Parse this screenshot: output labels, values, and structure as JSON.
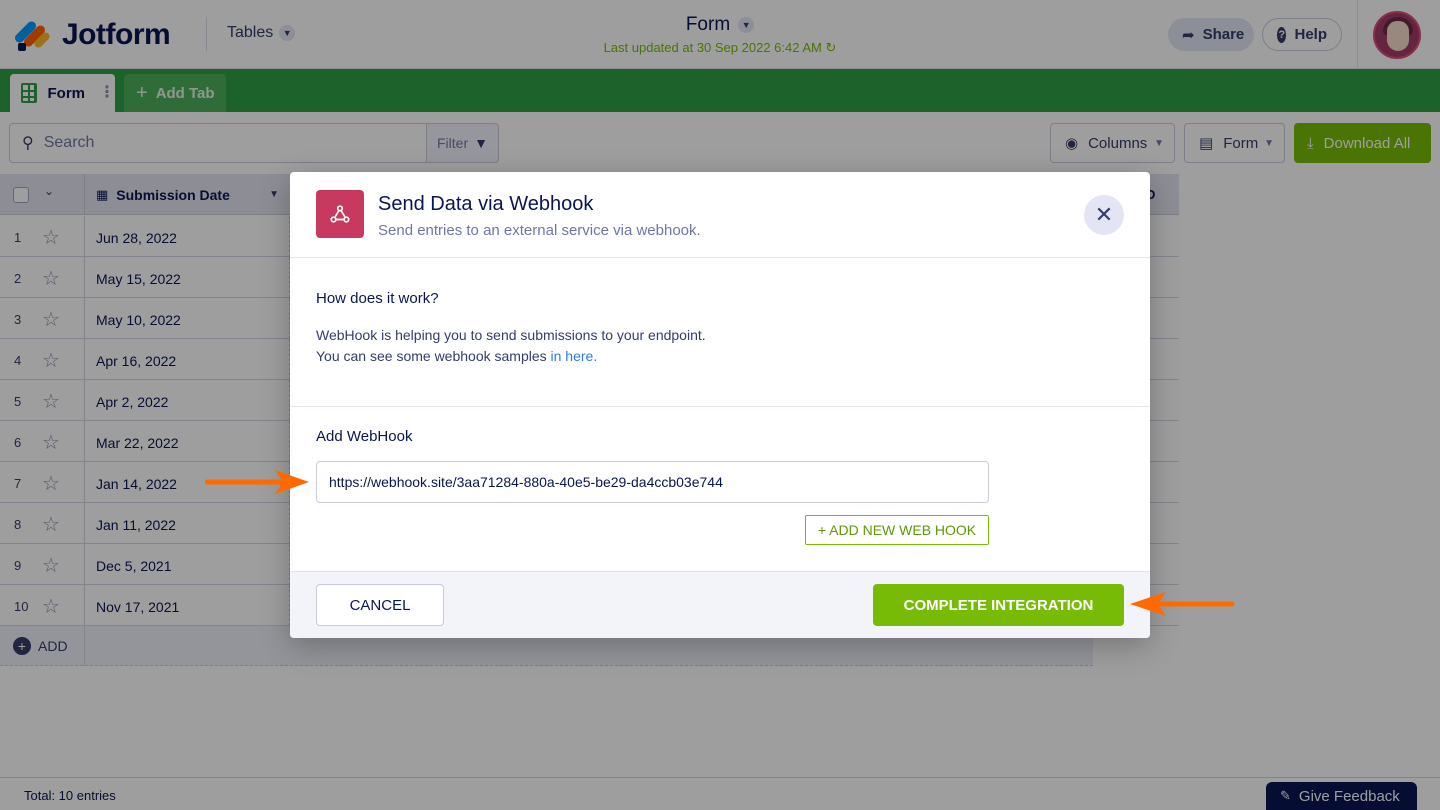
{
  "header": {
    "brand": "Jotform",
    "app_menu": "Tables",
    "doc_title": "Form",
    "last_updated": "Last updated at 30 Sep 2022 6:42 AM",
    "share_label": "Share",
    "help_label": "Help"
  },
  "tabs": {
    "items": [
      {
        "label": "Form"
      }
    ],
    "add_label": "Add Tab"
  },
  "toolbar": {
    "search_placeholder": "Search",
    "filter_label": "Filter",
    "columns_label": "Columns",
    "form_label": "Form",
    "download_label": "Download All"
  },
  "table": {
    "date_header": "Submission Date",
    "last_header": "D",
    "rows": [
      {
        "num": "1",
        "date": "Jun 28, 2022"
      },
      {
        "num": "2",
        "date": "May 15, 2022"
      },
      {
        "num": "3",
        "date": "May 10, 2022"
      },
      {
        "num": "4",
        "date": "Apr 16, 2022"
      },
      {
        "num": "5",
        "date": "Apr 2, 2022"
      },
      {
        "num": "6",
        "date": "Mar 22, 2022"
      },
      {
        "num": "7",
        "date": "Jan 14, 2022"
      },
      {
        "num": "8",
        "date": "Jan 11, 2022"
      },
      {
        "num": "9",
        "date": "Dec 5, 2021"
      },
      {
        "num": "10",
        "date": "Nov 17, 2021"
      }
    ],
    "add_label": "ADD"
  },
  "footer": {
    "total": "Total: 10 entries",
    "feedback_label": "Give Feedback"
  },
  "modal": {
    "title": "Send Data via Webhook",
    "subtitle": "Send entries to an external service via webhook.",
    "how_heading": "How does it work?",
    "how_line1": "WebHook is helping you to send submissions to your endpoint.",
    "how_line2": "You can see some webhook samples ",
    "how_link": "in here.",
    "add_heading": "Add WebHook",
    "webhook_url": "https://webhook.site/3aa71284-880a-40e5-be29-da4ccb03e744",
    "add_new_label": "+ ADD NEW WEB HOOK",
    "cancel_label": "CANCEL",
    "complete_label": "COMPLETE INTEGRATION"
  },
  "colors": {
    "brand_navy": "#0a1551",
    "tabbar_green": "#2f9e44",
    "action_green": "#78bb07",
    "webhook_red": "#c8395f",
    "annotation_orange": "#ff6a00"
  }
}
